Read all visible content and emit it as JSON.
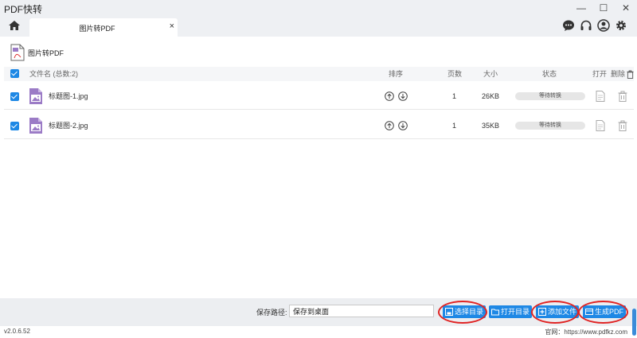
{
  "app": {
    "title": "PDF快转"
  },
  "window": {
    "minimize": "—",
    "maximize": "☐",
    "close": "✕"
  },
  "tab": {
    "label": "图片转PDF",
    "close": "×"
  },
  "section": {
    "title": "图片转PDF"
  },
  "table": {
    "headers": {
      "filename": "文件名 (总数:2)",
      "sort": "排序",
      "pages": "页数",
      "size": "大小",
      "status": "状态",
      "open": "打开",
      "delete": "删除"
    },
    "rows": [
      {
        "name": "标题图-1.jpg",
        "pages": "1",
        "size": "26KB",
        "status": "等待转换"
      },
      {
        "name": "标题图-2.jpg",
        "pages": "1",
        "size": "35KB",
        "status": "等待转换"
      }
    ]
  },
  "footer": {
    "save_label": "保存路径:",
    "save_path": "保存到桌面",
    "choose_dir": "选择目录",
    "open_dir": "打开目录",
    "add_file": "添加文件",
    "generate": "生成PDF"
  },
  "statusbar": {
    "version": "v2.0.6.52",
    "website": "官网：https://www.pdfkz.com"
  },
  "colors": {
    "accent": "#1e88e5",
    "highlight_ring": "#e02424",
    "file_icon": "#9b7bc6"
  }
}
